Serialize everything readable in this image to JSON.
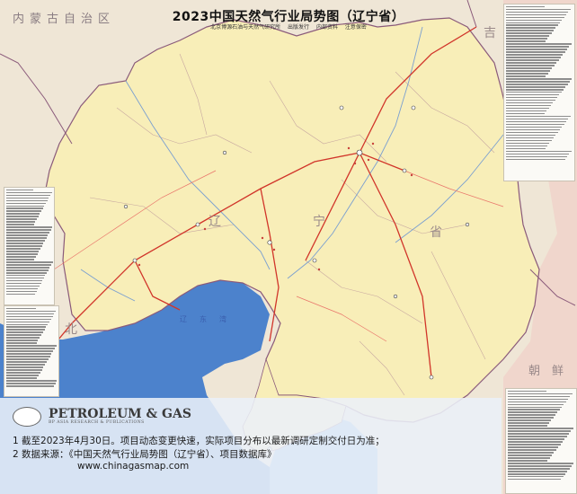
{
  "map": {
    "title": "2023中国天然气行业局势图（辽宁省）",
    "subtitle": "北京博源石油与天然气研究所 出版发行  内部资料  注意保密",
    "labels": {
      "inner_mongolia": "内蒙古自治区",
      "jilin_partial": "吉",
      "hebei_partial": "北",
      "korea_partial": "朝　鲜",
      "liaoning_1": "辽",
      "liaoning_2": "宁",
      "liaoning_3": "省",
      "liaodong_bay": "辽　东　湾"
    },
    "colors": {
      "province_fill": "#f8eeb8",
      "neighbor_fill": "#f0e4cf",
      "neighbor_fill_right": "#f0d9cf",
      "sea": "#3f79c9",
      "sea_light": "#86b4e6",
      "river": "#6d95c9",
      "pipeline_red": "#d1352a",
      "boundary": "#8a5a7a"
    }
  },
  "footer": {
    "logo_name": "PETROLEUM & GAS",
    "logo_sub": "BP ASIA RESEARCH & PUBLICATIONS",
    "note1": "1  截至2023年4月30日。项目动态变更快速，实际项目分布以最新调研定制交付日为准；",
    "note2": "2  数据来源：《中国天然气行业局势图（辽宁省）、项目数据库》",
    "website": "www.chinagasmap.com"
  }
}
